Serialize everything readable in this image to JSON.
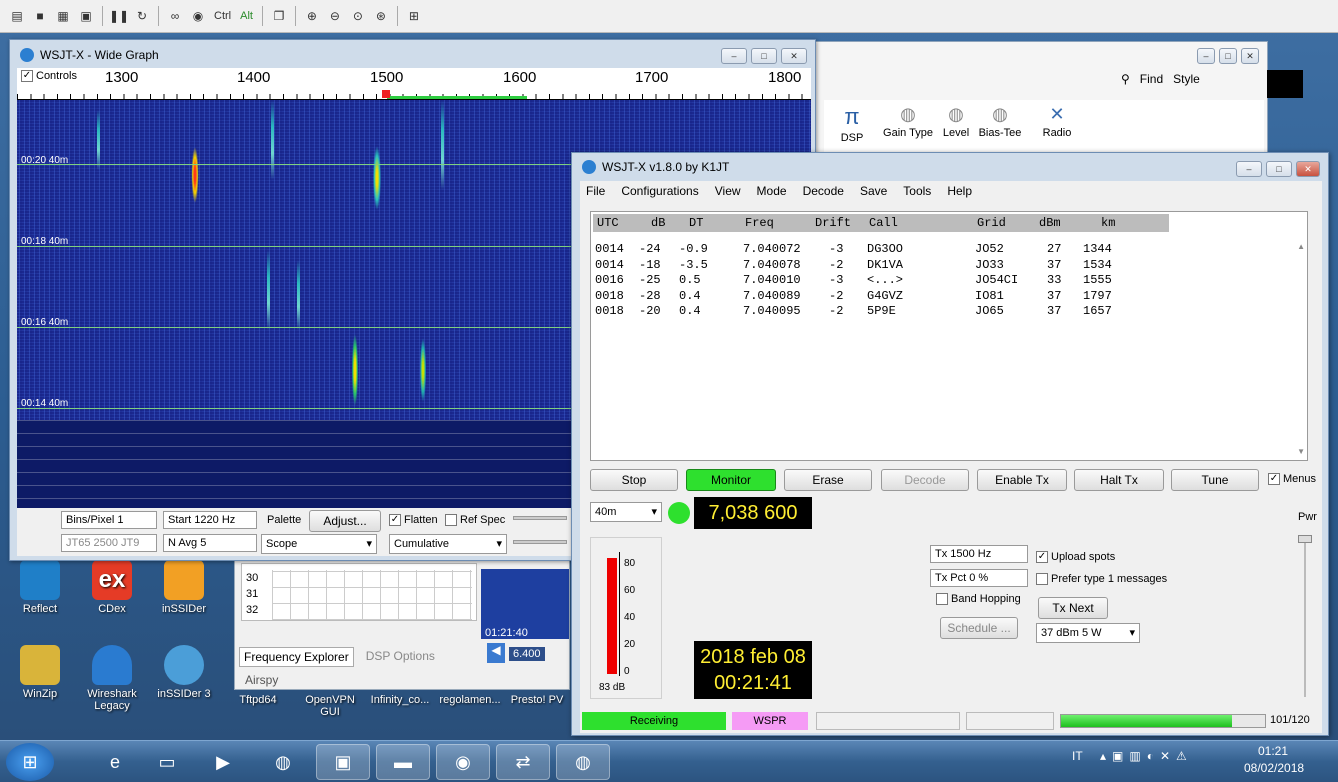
{
  "toolbar": {
    "ctrl_label": "Ctrl",
    "alt_label": "Alt"
  },
  "desktop_icons": [
    {
      "label": "Reflect"
    },
    {
      "label": "CDex"
    },
    {
      "label": "inSSIDer"
    },
    {
      "label": "WinZip"
    },
    {
      "label": "Wireshark Legacy"
    },
    {
      "label": "inSSIDer 3"
    },
    {
      "label": "Tftpd64"
    },
    {
      "label": "OpenVPN GUI"
    },
    {
      "label": "Infinity_co..."
    },
    {
      "label": "regolamen..."
    },
    {
      "label": "Presto! PV"
    }
  ],
  "wide_graph": {
    "title": "WSJT-X - Wide Graph",
    "controls_label": "Controls",
    "scale": [
      "1300",
      "1400",
      "1500",
      "1600",
      "1700",
      "1800"
    ],
    "time_labels": [
      "00:20  40m",
      "00:18  40m",
      "00:16  40m",
      "00:14  40m"
    ],
    "bins_pixel": "Bins/Pixel  1",
    "start": "Start 1220 Hz",
    "jt65_field": "JT65  2500  JT9",
    "navg": "N Avg 5",
    "palette_label": "Palette",
    "adjust_button": "Adjust...",
    "palette_value": "Scope",
    "flatten_label": "Flatten",
    "refspec_label": "Ref Spec",
    "cumulative_value": "Cumulative"
  },
  "sdr": {
    "find_label": "Find",
    "style_label": "Style",
    "ribbon": [
      "DSP",
      "Gain Type",
      "Level",
      "Bias-Tee",
      "Radio"
    ],
    "grid_rows": [
      "30",
      "31",
      "32"
    ],
    "tab_freq": "Frequency Explorer",
    "tab_dsp": "DSP Options",
    "airspy": "Airspy",
    "thumb_time": "01:21:40",
    "thumb_freq": "6.400"
  },
  "main": {
    "title": "WSJT-X   v1.8.0   by K1JT",
    "menu": [
      "File",
      "Configurations",
      "View",
      "Mode",
      "Decode",
      "Save",
      "Tools",
      "Help"
    ],
    "decode_headers": [
      "UTC",
      "dB",
      "DT",
      "Freq",
      "Drift",
      "Call",
      "Grid",
      "dBm",
      "km"
    ],
    "decodes": [
      [
        "0014",
        "-24",
        "-0.9",
        "7.040072",
        "-3",
        "DG3OO",
        "JO52",
        "27",
        "1344"
      ],
      [
        "0014",
        "-18",
        "-3.5",
        "7.040078",
        "-2",
        "DK1VA",
        "JO33",
        "37",
        "1534"
      ],
      [
        "0016",
        "-25",
        "0.5",
        "7.040010",
        "-3",
        "<...>",
        "JO54CI",
        "33",
        "1555"
      ],
      [
        "0018",
        "-28",
        "0.4",
        "7.040089",
        "-2",
        "G4GVZ",
        "IO81",
        "37",
        "1797"
      ],
      [
        "0018",
        "-20",
        "0.4",
        "7.040095",
        "-2",
        "5P9E",
        "JO65",
        "37",
        "1657"
      ]
    ],
    "buttons": [
      "Stop",
      "Monitor",
      "Erase",
      "Decode",
      "Enable Tx",
      "Halt Tx",
      "Tune"
    ],
    "menus_label": "Menus",
    "band": "40m",
    "frequency": "7,038 600",
    "pwr_label": "Pwr",
    "meter_ticks": [
      "80",
      "60",
      "40",
      "20",
      "0"
    ],
    "meter_db": "83 dB",
    "clock_date": "2018 feb 08",
    "clock_time": "00:21:41",
    "tx_hz": "Tx  1500  Hz",
    "tx_pct": "Tx Pct 0  %",
    "band_hopping": "Band Hopping",
    "schedule": "Schedule ...",
    "upload_spots": "Upload spots",
    "prefer_type1": "Prefer type 1 messages",
    "tx_next": "Tx Next",
    "power_select": "37 dBm  5 W",
    "status_receiving": "Receiving",
    "status_mode": "WSPR",
    "progress": 0.84,
    "progress_text": "101/120"
  },
  "taskbar": {
    "lang": "IT",
    "time": "01:21",
    "date": "08/02/2018"
  },
  "colors": {
    "monitor_green": "#2ee02e",
    "display_yellow": "#ffee33",
    "wspr_pink": "#f59bf5"
  }
}
